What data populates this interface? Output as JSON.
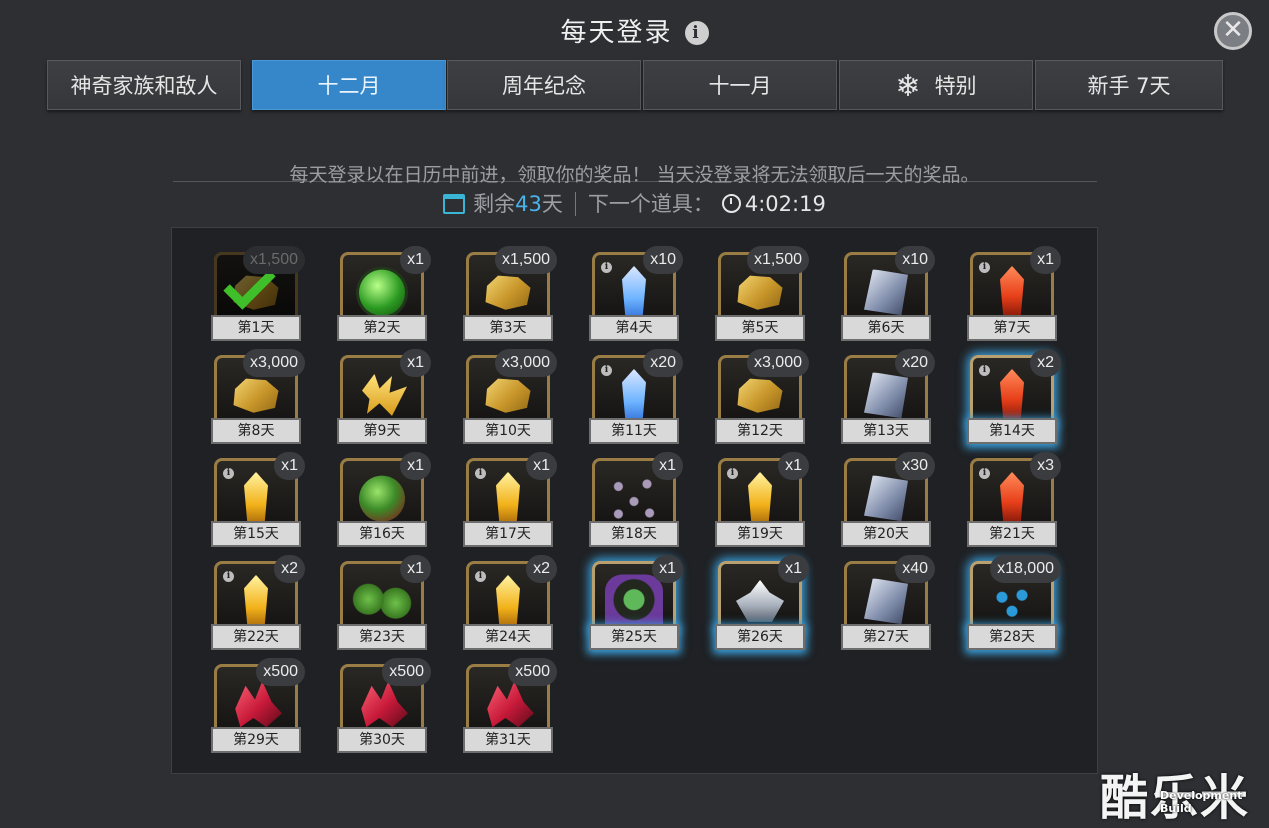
{
  "header": {
    "title": "每天登录"
  },
  "tabs": [
    {
      "label": "神奇家族和敌人",
      "active": false
    },
    {
      "label": "十二月",
      "active": true
    },
    {
      "label": "周年纪念",
      "active": false
    },
    {
      "label": "十一月",
      "active": false
    },
    {
      "label": "特别",
      "active": false,
      "icon": "snowflake-icon"
    },
    {
      "label": "新手 7天",
      "active": false
    }
  ],
  "description": "每天登录以在日历中前进，领取你的奖品！ 当天没登录将无法领取后一天的奖品。",
  "status": {
    "remaining_prefix": "剩余",
    "remaining_days": "43",
    "remaining_suffix": "天",
    "next_item_label": "下一个道具：",
    "timer": "4:02:19"
  },
  "rewards": [
    {
      "day": "第1天",
      "qty": "x1,500",
      "item": "gold-icon",
      "claimed": true
    },
    {
      "day": "第2天",
      "qty": "x1",
      "item": "green-orb-icon"
    },
    {
      "day": "第3天",
      "qty": "x1,500",
      "item": "gold-icon"
    },
    {
      "day": "第4天",
      "qty": "x10",
      "item": "blue-crystal-icon",
      "info": true
    },
    {
      "day": "第5天",
      "qty": "x1,500",
      "item": "gold-icon"
    },
    {
      "day": "第6天",
      "qty": "x10",
      "item": "silver-shard-icon"
    },
    {
      "day": "第7天",
      "qty": "x1",
      "item": "red-crystal-icon",
      "info": true
    },
    {
      "day": "第8天",
      "qty": "x3,000",
      "item": "gold-icon"
    },
    {
      "day": "第9天",
      "qty": "x1",
      "item": "energy-bolt-icon"
    },
    {
      "day": "第10天",
      "qty": "x3,000",
      "item": "gold-icon"
    },
    {
      "day": "第11天",
      "qty": "x20",
      "item": "blue-crystal-icon",
      "info": true
    },
    {
      "day": "第12天",
      "qty": "x3,000",
      "item": "gold-icon"
    },
    {
      "day": "第13天",
      "qty": "x20",
      "item": "silver-shard-icon"
    },
    {
      "day": "第14天",
      "qty": "x2",
      "item": "red-crystal-icon",
      "info": true,
      "highlight": true
    },
    {
      "day": "第15天",
      "qty": "x1",
      "item": "yellow-crystal-icon",
      "info": true
    },
    {
      "day": "第16天",
      "qty": "x1",
      "item": "earth-orb-icon"
    },
    {
      "day": "第17天",
      "qty": "x1",
      "item": "yellow-crystal-icon",
      "info": true
    },
    {
      "day": "第18天",
      "qty": "x1",
      "item": "network-icon"
    },
    {
      "day": "第19天",
      "qty": "x1",
      "item": "yellow-crystal-icon",
      "info": true
    },
    {
      "day": "第20天",
      "qty": "x30",
      "item": "silver-shard-icon"
    },
    {
      "day": "第21天",
      "qty": "x3",
      "item": "red-crystal-icon",
      "info": true
    },
    {
      "day": "第22天",
      "qty": "x2",
      "item": "yellow-crystal-icon",
      "info": true
    },
    {
      "day": "第23天",
      "qty": "x1",
      "item": "double-orb-icon"
    },
    {
      "day": "第24天",
      "qty": "x2",
      "item": "yellow-crystal-icon",
      "info": true
    },
    {
      "day": "第25天",
      "qty": "x1",
      "item": "champion-icon",
      "highlight": true
    },
    {
      "day": "第26天",
      "qty": "x1",
      "item": "silver-crystal-icon",
      "highlight": true
    },
    {
      "day": "第27天",
      "qty": "x40",
      "item": "silver-shard-icon"
    },
    {
      "day": "第28天",
      "qty": "x18,000",
      "item": "molecule-icon",
      "highlight": true
    },
    {
      "day": "第29天",
      "qty": "x500",
      "item": "ruby-icon"
    },
    {
      "day": "第30天",
      "qty": "x500",
      "item": "ruby-icon"
    },
    {
      "day": "第31天",
      "qty": "x500",
      "item": "ruby-icon"
    }
  ],
  "watermark": "酷乐米",
  "dev_build": "Development Build",
  "colors": {
    "accent": "#3587c9",
    "highlight_glow": "#3aa0dc",
    "remaining_days": "#4ab4ea"
  }
}
